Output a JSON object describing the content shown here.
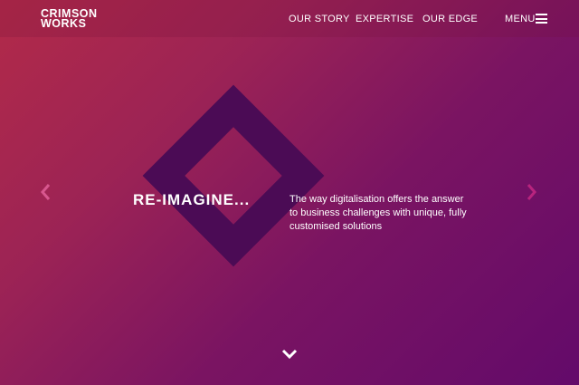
{
  "brand": {
    "logo_line1": "CRIMSON",
    "logo_line2": "WORKS"
  },
  "nav": {
    "items": [
      {
        "label": "OUR STORY"
      },
      {
        "label": "EXPERTISE"
      },
      {
        "label": "OUR EDGE"
      }
    ],
    "menu_label": "MENU",
    "menu_icon": "hamburger-icon"
  },
  "hero": {
    "headline": "RE-IMAGINE...",
    "description": "The way digitalisation offers the answer to business challenges with unique, fully customised solutions"
  },
  "controls": {
    "prev_icon": "chevron-left-icon",
    "next_icon": "chevron-right-icon",
    "scroll_icon": "chevron-down-icon"
  },
  "colors": {
    "gradient_start": "#b22a49",
    "gradient_end": "#630a6a",
    "diamond": "#4b0b55",
    "arrow_left": "#d8578e",
    "arrow_right": "#b8247e"
  }
}
